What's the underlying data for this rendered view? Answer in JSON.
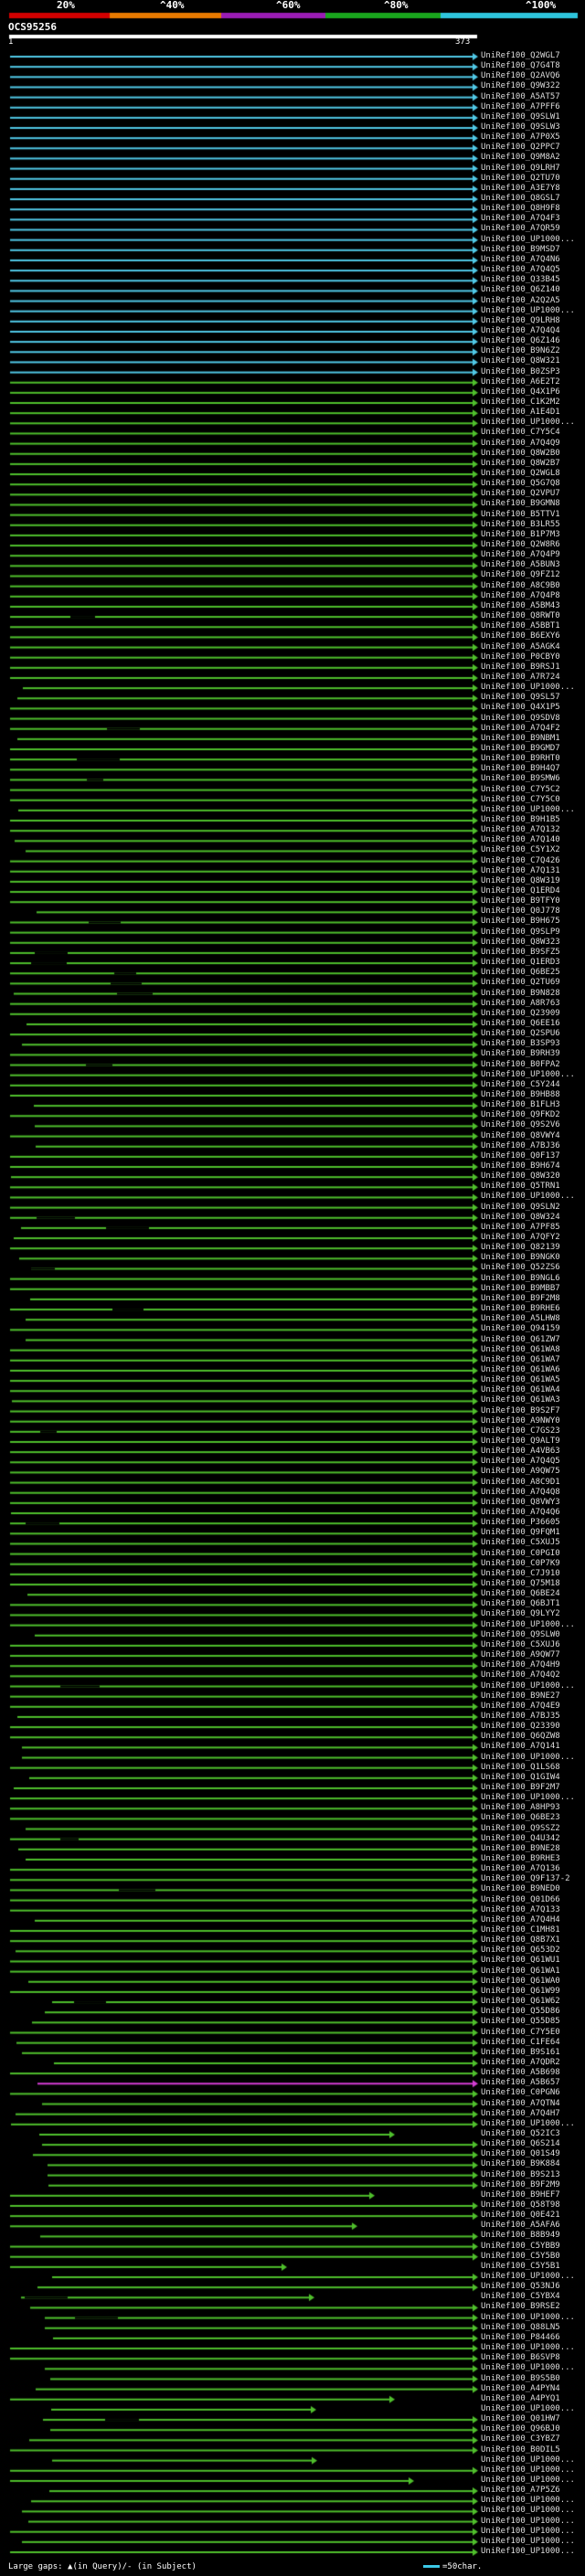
{
  "colors": {
    "red": "#d20000",
    "orange": "#e87a00",
    "purple": "#9a1cb4",
    "green": "#19a51d",
    "cyan": "#2ec4dc",
    "magenta": "#d23cd2",
    "green_line": "#4fbf2c",
    "cyan_line": "#50c8e6",
    "label": "#dcdcdc"
  },
  "legend": {
    "p20": "20%",
    "p40": "^40%",
    "p60": "^60%",
    "p80": "^80%",
    "p100": "^100%"
  },
  "query": {
    "id": "OCS95256",
    "start": "1",
    "end": "373"
  },
  "hits": [
    "UniRef100_Q2WGL7",
    "UniRef100_Q7G4T8",
    "UniRef100_Q2AVQ6",
    "UniRef100_Q9W322",
    "UniRef100_A5AT57",
    "UniRef100_A7PFF6",
    "UniRef100_Q9SLW1",
    "UniRef100_Q9SLW3",
    "UniRef100_A7P0X5",
    "UniRef100_Q2PPC7",
    "UniRef100_Q9M8A2",
    "UniRef100_Q9LRH7",
    "UniRef100_Q2TU70",
    "UniRef100_A3E7Y8",
    "UniRef100_Q8GSL7",
    "UniRef100_Q8H9F8",
    "UniRef100_A7Q4F3",
    "UniRef100_A7QR59",
    "UniRef100_UP1000...",
    "UniRef100_B9MSD7",
    "UniRef100_A7Q4N6",
    "UniRef100_A7Q4Q5",
    "UniRef100_Q33B45",
    "UniRef100_Q6Z140",
    "UniRef100_A2Q2A5",
    "UniRef100_UP1000...",
    "UniRef100_Q9LRH8",
    "UniRef100_A7Q4Q4",
    "UniRef100_Q6Z146",
    "UniRef100_B9N6Z2",
    "UniRef100_Q8W321",
    "UniRef100_B0ZSP3",
    "UniRef100_A6E2T2",
    "UniRef100_Q4X1P6",
    "UniRef100_C1K2M2",
    "UniRef100_A1E4D1",
    "UniRef100_UP1000...",
    "UniRef100_C7Y5C4",
    "UniRef100_A7Q4Q9",
    "UniRef100_Q8W2B0",
    "UniRef100_Q8W2B7",
    "UniRef100_Q2WGL8",
    "UniRef100_Q5G7Q8",
    "UniRef100_Q2VPU7",
    "UniRef100_B9GMN8",
    "UniRef100_B5TTV1",
    "UniRef100_B3LR55",
    "UniRef100_B1P7M3",
    "UniRef100_Q2W8R6",
    "UniRef100_A7Q4P9",
    "UniRef100_A5BUN3",
    "UniRef100_Q9FZ12",
    "UniRef100_A8C9B0",
    "UniRef100_A7Q4P8",
    "UniRef100_A5BM43",
    "UniRef100_Q8RWT0",
    "UniRef100_A5BBT1",
    "UniRef100_B6EXY6",
    "UniRef100_A5AGK4",
    "UniRef100_P0CBY0",
    "UniRef100_B9RSJ1",
    "UniRef100_A7R724",
    "UniRef100_UP1000...",
    "UniRef100_Q9SL57",
    "UniRef100_Q4X1P5",
    "UniRef100_Q9SDV8",
    "UniRef100_A7Q4F2",
    "UniRef100_B9NBM1",
    "UniRef100_B9GMD7",
    "UniRef100_B9RHT0",
    "UniRef100_B9H4Q7",
    "UniRef100_B9SMW6",
    "UniRef100_C7Y5C2",
    "UniRef100_C7Y5C0",
    "UniRef100_UP1000...",
    "UniRef100_B9H1B5",
    "UniRef100_A7Q132",
    "UniRef100_A7Q140",
    "UniRef100_C5Y1X2",
    "UniRef100_C7Q426",
    "UniRef100_A7Q131",
    "UniRef100_Q8W319",
    "UniRef100_Q1ERD4",
    "UniRef100_B9TFY0",
    "UniRef100_Q0J778",
    "UniRef100_B9H675",
    "UniRef100_Q9SLP9",
    "UniRef100_Q8W323",
    "UniRef100_B9SFZ5",
    "UniRef100_Q1ERD3",
    "UniRef100_Q6BE25",
    "UniRef100_Q2TU69",
    "UniRef100_B9N828",
    "UniRef100_A8R763",
    "UniRef100_Q23909",
    "UniRef100_Q6EE16",
    "UniRef100_Q2SPU6",
    "UniRef100_B3SP93",
    "UniRef100_B9RH39",
    "UniRef100_B0FPA2",
    "UniRef100_UP1000...",
    "UniRef100_C5Y244",
    "UniRef100_B9HB88",
    "UniRef100_B1FLH3",
    "UniRef100_Q9FKD2",
    "UniRef100_Q9S2V6",
    "UniRef100_Q8VWY4",
    "UniRef100_A7BJ36",
    "UniRef100_Q0F137",
    "UniRef100_B9H674",
    "UniRef100_Q8W320",
    "UniRef100_Q5TRN1",
    "UniRef100_UP1000...",
    "UniRef100_Q9SLN2",
    "UniRef100_Q8W324",
    "UniRef100_A7PF85",
    "UniRef100_A7QFY2",
    "UniRef100_Q82139",
    "UniRef100_B9NGK0",
    "UniRef100_Q52ZS6",
    "UniRef100_B9NGL6",
    "UniRef100_B9MBB7",
    "UniRef100_B9F2M8",
    "UniRef100_B9RHE6",
    "UniRef100_A5LHW8",
    "UniRef100_Q94159",
    "UniRef100_Q61ZW7",
    "UniRef100_Q61WA8",
    "UniRef100_Q61WA7",
    "UniRef100_Q61WA6",
    "UniRef100_Q61WA5",
    "UniRef100_Q61WA4",
    "UniRef100_Q61WA3",
    "UniRef100_B9S2F7",
    "UniRef100_A9NWY0",
    "UniRef100_C7GS23",
    "UniRef100_Q9ALT9",
    "UniRef100_A4VB63",
    "UniRef100_A7Q4Q5",
    "UniRef100_A9QW75",
    "UniRef100_A8C9D1",
    "UniRef100_A7Q4Q8",
    "UniRef100_Q8VWY3",
    "UniRef100_A7Q4Q6",
    "UniRef100_P36605",
    "UniRef100_Q9FQM1",
    "UniRef100_C5XUJ5",
    "UniRef100_C0PGI0",
    "UniRef100_C0P7K9",
    "UniRef100_C7J910",
    "UniRef100_Q75M18",
    "UniRef100_Q6BE24",
    "UniRef100_Q6BJT1",
    "UniRef100_Q9LYY2",
    "UniRef100_UP1000...",
    "UniRef100_Q9SLW0",
    "UniRef100_C5XUJ6",
    "UniRef100_A9QW77",
    "UniRef100_A7Q4H9",
    "UniRef100_A7Q4Q2",
    "UniRef100_UP1000...",
    "UniRef100_B9NE27",
    "UniRef100_A7Q4E9",
    "UniRef100_A7BJ35",
    "UniRef100_Q23390",
    "UniRef100_Q6QZW8",
    "UniRef100_A7Q141",
    "UniRef100_UP1000...",
    "UniRef100_Q1LS68",
    "UniRef100_Q1GIW4",
    "UniRef100_B9F2M7",
    "UniRef100_UP1000...",
    "UniRef100_A8HP93",
    "UniRef100_Q6BE23",
    "UniRef100_Q9SSZ2",
    "UniRef100_Q4U342",
    "UniRef100_B9NE28",
    "UniRef100_B9RHE3",
    "UniRef100_A7Q136",
    "UniRef100_Q9F137-2",
    "UniRef100_B9NED0",
    "UniRef100_Q01D66",
    "UniRef100_A7Q133",
    "UniRef100_A7Q4H4",
    "UniRef100_C1MH81",
    "UniRef100_Q8B7X1",
    "UniRef100_Q653D2",
    "UniRef100_Q61WU1",
    "UniRef100_Q61WA1",
    "UniRef100_Q61WA0",
    "UniRef100_Q61W99",
    "UniRef100_Q61W62",
    "UniRef100_Q55D86",
    "UniRef100_Q55D85",
    "UniRef100_C7Y5E0",
    "UniRef100_C1FE64",
    "UniRef100_B9S161",
    "UniRef100_A7QDR2",
    "UniRef100_A5B698",
    "UniRef100_A5B657",
    "UniRef100_C0PGN6",
    "UniRef100_A7QTN4",
    "UniRef100_A7Q4H7",
    "UniRef100_UP1000...",
    "UniRef100_Q52IC3",
    "UniRef100_Q6S214",
    "UniRef100_Q01S49",
    "UniRef100_B9K884",
    "UniRef100_B9S213",
    "UniRef100_B9F2M9",
    "UniRef100_B9HEF7",
    "UniRef100_Q58T98",
    "UniRef100_Q0E421",
    "UniRef100_A5AFA6",
    "UniRef100_B8B949",
    "UniRef100_C5YBB9",
    "UniRef100_C5Y5B0",
    "UniRef100_C5Y5B1",
    "UniRef100_UP1000...",
    "UniRef100_Q53NJ6",
    "UniRef100_C5YBX4",
    "UniRef100_B9RSE2",
    "UniRef100_UP1000...",
    "UniRef100_Q88LN5",
    "UniRef100_P84466",
    "UniRef100_UP1000...",
    "UniRef100_B6SVP8",
    "UniRef100_UP1000...",
    "UniRef100_B9S5B0",
    "UniRef100_A4PYN4",
    "UniRef100_A4PYQ1",
    "UniRef100_UP1000...",
    "UniRef100_Q01HW7",
    "UniRef100_Q96BJ0",
    "UniRef100_C3YBZ7",
    "UniRef100_B0DIL5",
    "UniRef100_UP1000...",
    "UniRef100_UP1000...",
    "UniRef100_UP1000...",
    "UniRef100_A7P5Z6",
    "UniRef100_UP1000...",
    "UniRef100_UP1000...",
    "UniRef100_UP1000...",
    "UniRef100_UP1000...",
    "UniRef100_UP1000...",
    "UniRef100_UP1000..."
  ],
  "footer": {
    "gaps_text": "Large gaps: ▲(in Query)/- (in Subject)",
    "scale_text": "=50char."
  }
}
